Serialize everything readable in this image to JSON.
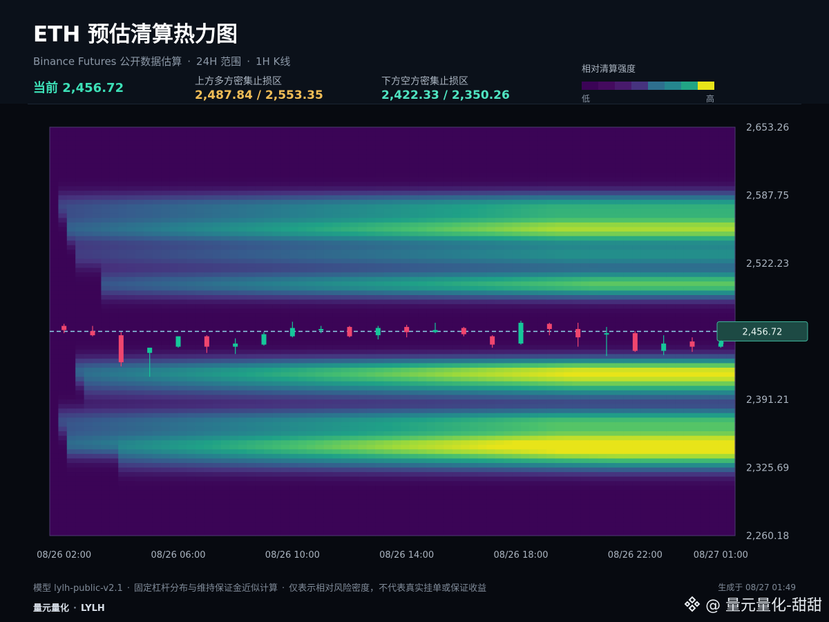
{
  "header": {
    "title": "ETH 预估清算热力图",
    "subtitle_parts": [
      "Binance Futures 公开数据估算",
      "24H 范围",
      "1H K线"
    ],
    "separator": "·",
    "current_label": "当前 2,456.72",
    "upper_label": "上方多方密集止损区",
    "upper_value": "2,487.84 / 2,553.35",
    "lower_label": "下方空方密集止损区",
    "lower_value": "2,422.33 / 2,350.26"
  },
  "legend": {
    "title": "相对清算强度",
    "low": "低",
    "high": "高",
    "colors": [
      "#3b0456",
      "#440b5e",
      "#481a6c",
      "#46337e",
      "#2e6f8e",
      "#25868e",
      "#21a585",
      "#e8e419"
    ]
  },
  "chart_data": {
    "type": "heatmap",
    "title": "ETH 预估清算热力图",
    "xlabel": "",
    "ylabel": "",
    "ylim": [
      2260.18,
      2653.26
    ],
    "y_ticks": [
      "2,653.26",
      "2,587.75",
      "2,522.23",
      "2,391.21",
      "2,325.69",
      "2,260.18"
    ],
    "x_ticks": [
      "08/26 02:00",
      "08/26 06:00",
      "08/26 10:00",
      "08/26 14:00",
      "08/26 18:00",
      "08/26 22:00",
      "08/27 01:00"
    ],
    "current_price": 2456.72,
    "current_price_label": "2,456.72",
    "colors": {
      "up": "#16c79a",
      "down": "#f0466e",
      "price_line": "#8fd6e8",
      "tag_bg": "#1d4a44",
      "tag_border": "#3fb39a",
      "colormap": [
        "#3b0456",
        "#46337e",
        "#365c8d",
        "#277f8e",
        "#1fa187",
        "#4ac16d",
        "#a0da39",
        "#e8e419"
      ]
    },
    "bands": [
      {
        "price": 2577,
        "start_hour": 0.2,
        "peak": 0.62
      },
      {
        "price": 2555,
        "start_hour": 0.5,
        "peak": 0.88
      },
      {
        "price": 2530,
        "start_hour": 0.8,
        "peak": 0.5
      },
      {
        "price": 2502,
        "start_hour": 1.8,
        "peak": 0.78
      },
      {
        "price": 2418,
        "start_hour": 1.0,
        "peak": 0.95
      },
      {
        "price": 2402,
        "start_hour": 1.2,
        "peak": 0.45
      },
      {
        "price": 2370,
        "start_hour": 0.3,
        "peak": 0.7
      },
      {
        "price": 2348,
        "start_hour": 0.6,
        "peak": 1.0
      },
      {
        "price": 2333,
        "start_hour": 2.5,
        "peak": 0.5
      }
    ],
    "candles": [
      {
        "x": 0,
        "o": 2462,
        "h": 2464,
        "l": 2455,
        "c": 2458
      },
      {
        "x": 1,
        "o": 2457,
        "h": 2462,
        "l": 2452,
        "c": 2453
      },
      {
        "x": 2,
        "o": 2453,
        "h": 2456,
        "l": 2423,
        "c": 2427
      },
      {
        "x": 3,
        "o": 2436,
        "h": 2440,
        "l": 2413,
        "c": 2441
      },
      {
        "x": 4,
        "o": 2442,
        "h": 2452,
        "l": 2441,
        "c": 2452
      },
      {
        "x": 5,
        "o": 2452,
        "h": 2453,
        "l": 2436,
        "c": 2442
      },
      {
        "x": 6,
        "o": 2442,
        "h": 2450,
        "l": 2435,
        "c": 2445
      },
      {
        "x": 7,
        "o": 2444,
        "h": 2456,
        "l": 2443,
        "c": 2454
      },
      {
        "x": 8,
        "o": 2452,
        "h": 2466,
        "l": 2451,
        "c": 2460
      },
      {
        "x": 9,
        "o": 2458,
        "h": 2462,
        "l": 2455,
        "c": 2459
      },
      {
        "x": 10,
        "o": 2461,
        "h": 2462,
        "l": 2451,
        "c": 2452
      },
      {
        "x": 11,
        "o": 2453,
        "h": 2462,
        "l": 2449,
        "c": 2460
      },
      {
        "x": 12,
        "o": 2461,
        "h": 2463,
        "l": 2451,
        "c": 2456
      },
      {
        "x": 13,
        "o": 2456,
        "h": 2465,
        "l": 2455,
        "c": 2458
      },
      {
        "x": 14,
        "o": 2460,
        "h": 2461,
        "l": 2452,
        "c": 2454
      },
      {
        "x": 15,
        "o": 2452,
        "h": 2453,
        "l": 2441,
        "c": 2444
      },
      {
        "x": 16,
        "o": 2445,
        "h": 2467,
        "l": 2444,
        "c": 2465
      },
      {
        "x": 17,
        "o": 2464,
        "h": 2465,
        "l": 2453,
        "c": 2459
      },
      {
        "x": 18,
        "o": 2459,
        "h": 2465,
        "l": 2442,
        "c": 2451
      },
      {
        "x": 19,
        "o": 2454,
        "h": 2461,
        "l": 2433,
        "c": 2455
      },
      {
        "x": 20,
        "o": 2455,
        "h": 2457,
        "l": 2437,
        "c": 2438
      },
      {
        "x": 21,
        "o": 2438,
        "h": 2453,
        "l": 2434,
        "c": 2445
      },
      {
        "x": 22,
        "o": 2447,
        "h": 2451,
        "l": 2437,
        "c": 2442
      },
      {
        "x": 23,
        "o": 2442,
        "h": 2447,
        "l": 2441,
        "c": 2445
      }
    ]
  },
  "footer": {
    "note_parts": [
      "模型 lylh-public-v2.1",
      "固定杠杆分布与维持保证金近似计算",
      "仅表示相对风险密度，不代表真实挂单或保证收益"
    ],
    "brand_parts": [
      "量元量化",
      "LYLH"
    ],
    "generated": "生成于 08/27 01:49",
    "watermark": "@ 量元量化-甜甜"
  }
}
